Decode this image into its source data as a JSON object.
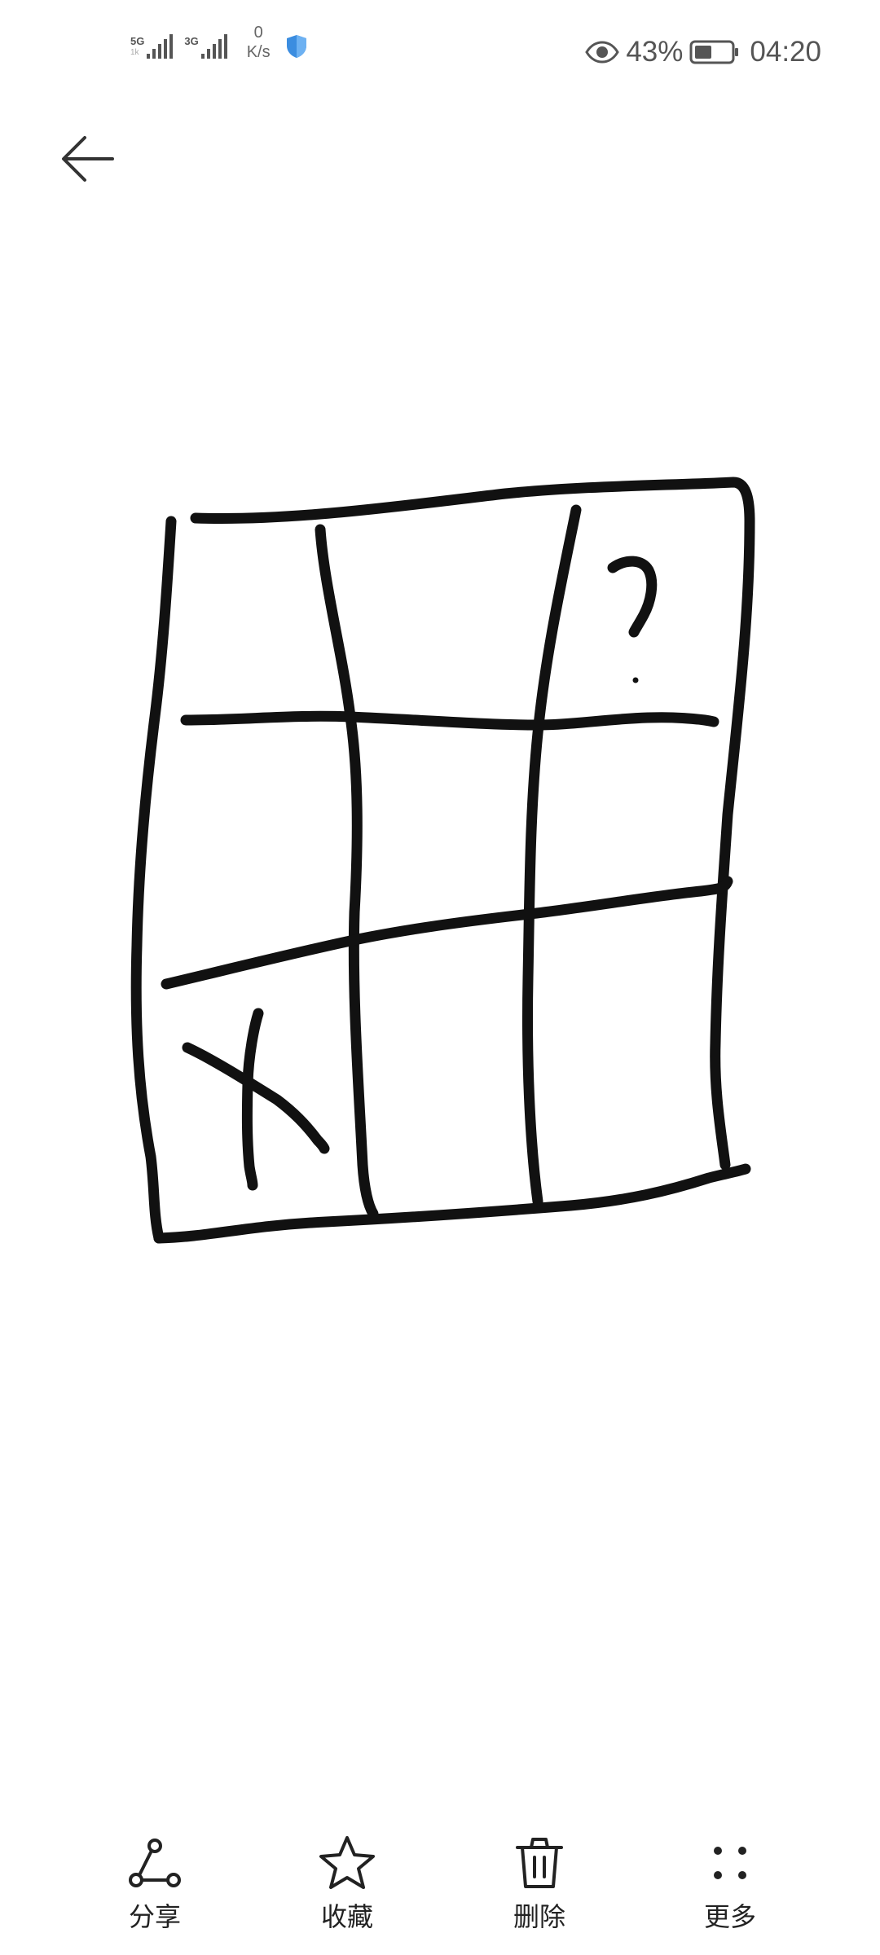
{
  "status_bar": {
    "net1": "5G",
    "net1_sub": "1k",
    "net2": "3G",
    "speed_value": "0",
    "speed_unit": "K/s",
    "battery": "43%",
    "time": "04:20"
  },
  "toolbar": {
    "share_label": "分享",
    "favorite_label": "收藏",
    "delete_label": "删除",
    "more_label": "更多"
  },
  "drawing": {
    "grid_mark": "X",
    "corner_mark": "?"
  },
  "icons": {
    "back": "back-arrow-icon",
    "share": "share-icon",
    "favorite": "star-icon",
    "delete": "trash-icon",
    "more": "more-dots-icon"
  }
}
